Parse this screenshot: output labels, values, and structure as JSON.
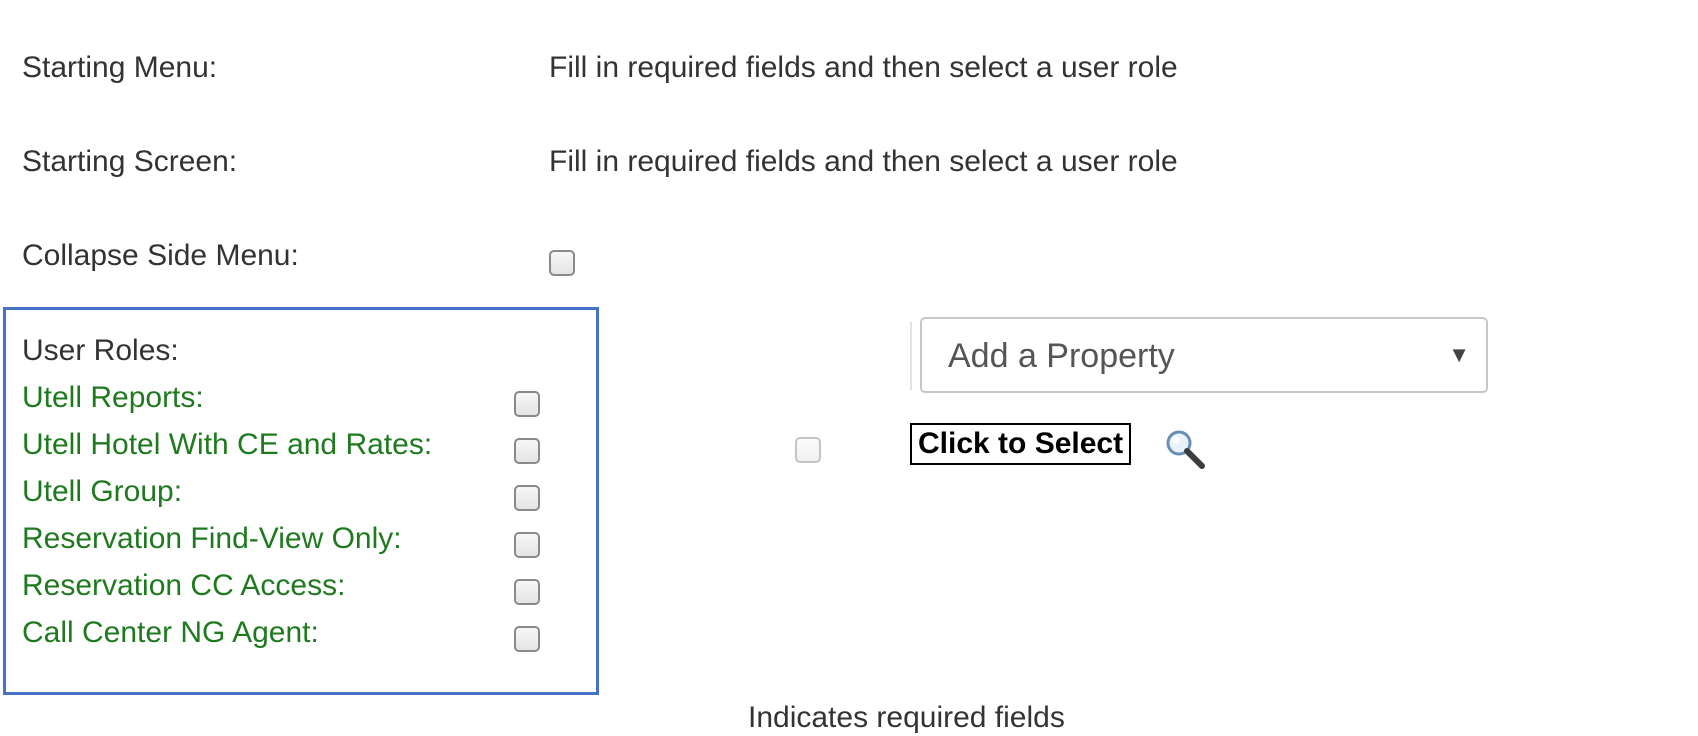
{
  "fields": {
    "starting_menu_label": "Starting Menu:",
    "starting_menu_value": "Fill in required fields and then select a user role",
    "starting_screen_label": "Starting Screen:",
    "starting_screen_value": "Fill in required fields and then select a user role",
    "collapse_side_menu_label": "Collapse Side Menu:"
  },
  "user_roles": {
    "heading": "User Roles:",
    "items": [
      {
        "label": "Utell Reports:",
        "checked": false
      },
      {
        "label": "Utell Hotel With CE and Rates:",
        "checked": false
      },
      {
        "label": "Utell Group:",
        "checked": false
      },
      {
        "label": "Reservation Find-View Only:",
        "checked": false
      },
      {
        "label": "Reservation CC Access:",
        "checked": false
      },
      {
        "label": "Call Center NG Agent:",
        "checked": false
      }
    ]
  },
  "property": {
    "select_value": "Add a Property",
    "arrow": "▼",
    "click_to_select_label": "Click to Select",
    "search_icon": "magnifier-icon"
  },
  "footer": {
    "required_note": "Indicates required fields"
  },
  "colors": {
    "role_label": "#1f7a1f",
    "highlight_border": "#4472c4",
    "text": "#333333"
  }
}
